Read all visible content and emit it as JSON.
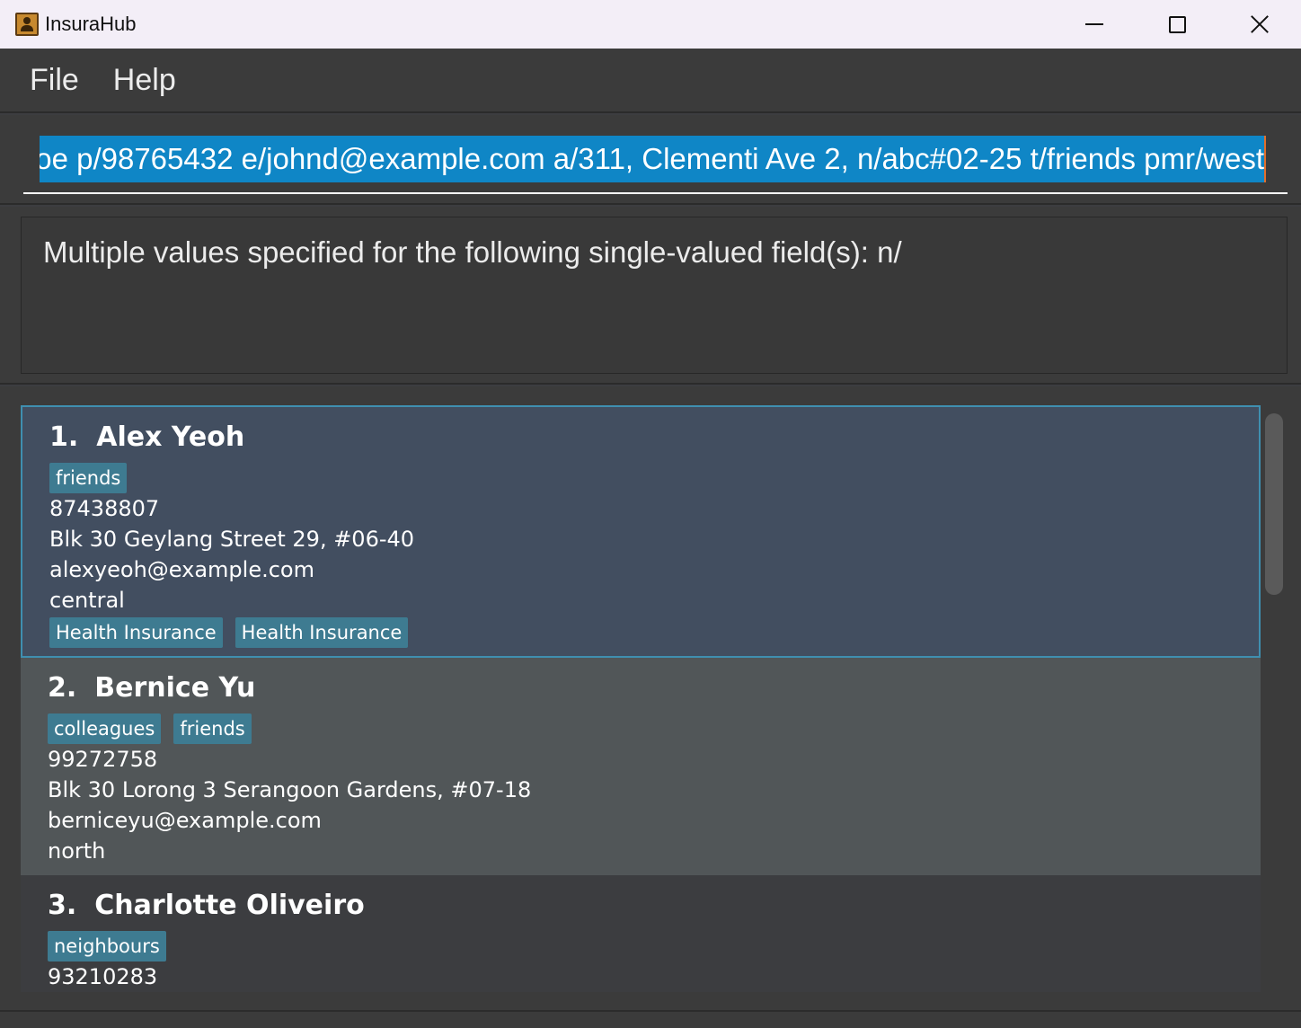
{
  "window": {
    "title": "InsuraHub",
    "icon": "addressbook-icon",
    "controls": [
      "minimize-icon",
      "maximize-icon",
      "close-icon"
    ]
  },
  "menu": {
    "file": "File",
    "help": "Help"
  },
  "command": {
    "value": "oe p/98765432 e/johnd@example.com a/311, Clementi Ave 2, n/abc#02-25 t/friends pmr/west"
  },
  "result": {
    "message": "Multiple values specified for the following single-valued field(s): n/"
  },
  "persons": [
    {
      "index": "1.",
      "name": "Alex Yeoh",
      "tags": [
        "friends"
      ],
      "phone": "87438807",
      "address": "Blk 30 Geylang Street 29, #06-40",
      "email": "alexyeoh@example.com",
      "region": "central",
      "policies": [
        "Health Insurance",
        "Health Insurance"
      ]
    },
    {
      "index": "2.",
      "name": "Bernice Yu",
      "tags": [
        "colleagues",
        "friends"
      ],
      "phone": "99272758",
      "address": "Blk 30 Lorong 3 Serangoon Gardens, #07-18",
      "email": "berniceyu@example.com",
      "region": "north"
    },
    {
      "index": "3.",
      "name": "Charlotte Oliveiro",
      "tags": [
        "neighbours"
      ],
      "phone": "93210283"
    }
  ],
  "colors": {
    "selection": "#0f86c6",
    "tag": "#3e7b91",
    "selected_card": "#424e60",
    "selected_border": "#3f8fb0"
  }
}
